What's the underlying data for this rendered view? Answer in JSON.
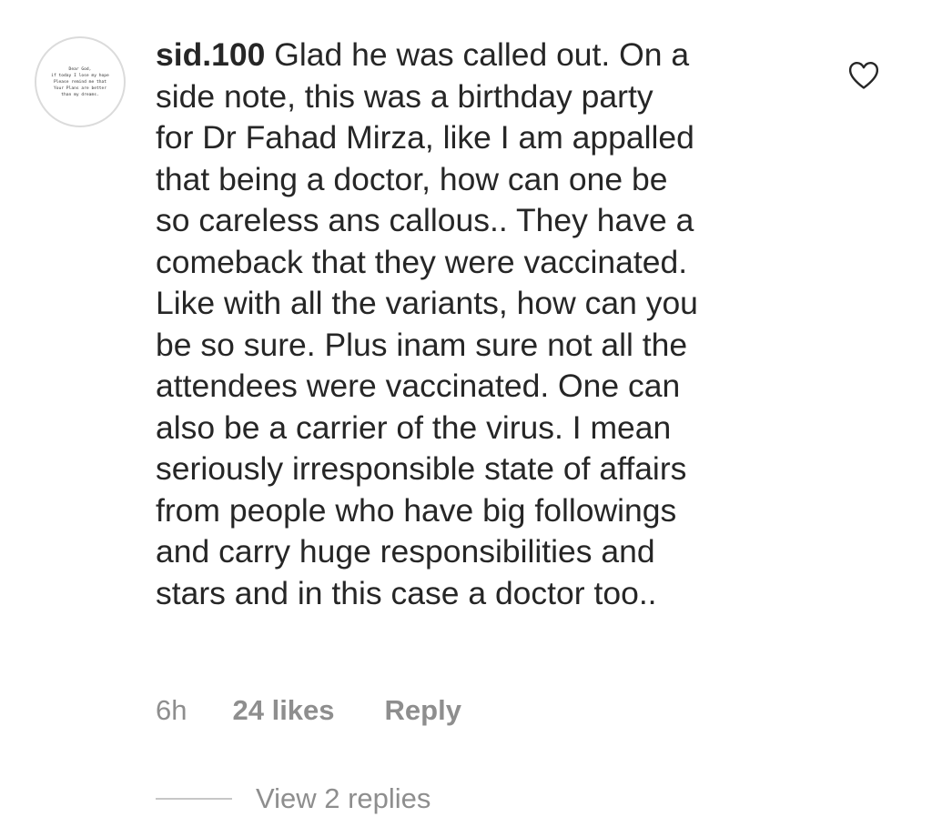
{
  "comment": {
    "avatar_text": [
      "Dear God,",
      "if today I lose my hope",
      "Please remind me that",
      "Your Plans are better",
      "than my dreams."
    ],
    "username": "sid.100",
    "text": " Glad he was called out. On a\nside note, this was a birthday party\nfor Dr Fahad Mirza, like I am appalled\nthat being a doctor, how can one be\nso careless ans callous.. They have a\ncomeback that they were vaccinated.\nLike with all the variants, how can you\nbe so sure. Plus inam sure not all the\nattendees were vaccinated. One can\nalso be a carrier of the virus. I mean\nseriously irresponsible state of affairs\nfrom people who have big followings\nand carry huge responsibilities and\nstars and in this case a doctor too..",
    "like_icon": "heart-outline-icon",
    "time": "6h",
    "likes": "24 likes",
    "reply_label": "Reply",
    "view_replies": "View 2 replies"
  },
  "colors": {
    "text": "#262626",
    "secondary": "#8e8e8e",
    "divider": "#c7c7c7",
    "avatar_border": "#dbdbdb"
  }
}
